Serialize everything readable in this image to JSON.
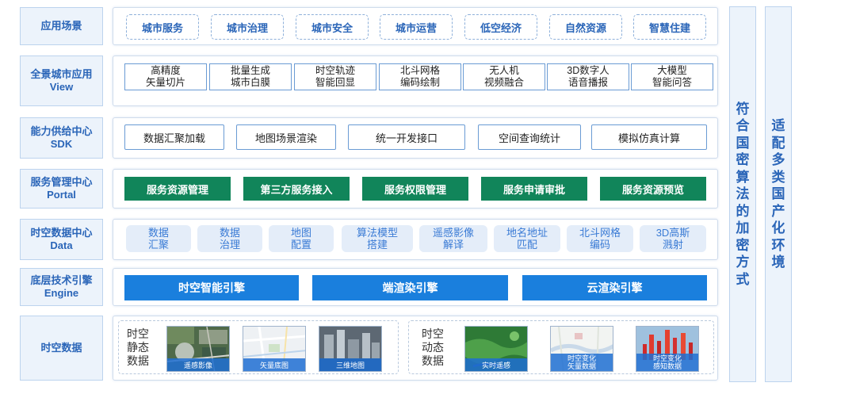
{
  "rows": {
    "application_scenes": {
      "label": [
        "应用场景"
      ],
      "items": [
        "城市服务",
        "城市治理",
        "城市安全",
        "城市运营",
        "低空经济",
        "自然资源",
        "智慧住建"
      ]
    },
    "view": {
      "label": [
        "全景城市应用",
        "View"
      ],
      "items": [
        [
          "高精度",
          "矢量切片"
        ],
        [
          "批量生成",
          "城市白膜"
        ],
        [
          "时空轨迹",
          "智能回显"
        ],
        [
          "北斗网格",
          "编码绘制"
        ],
        [
          "无人机",
          "视频融合"
        ],
        [
          "3D数字人",
          "语音播报"
        ],
        [
          "大模型",
          "智能问答"
        ]
      ]
    },
    "sdk": {
      "label": [
        "能力供给中心",
        "SDK"
      ],
      "items": [
        "数据汇聚加载",
        "地图场景渲染",
        "统一开发接口",
        "空间查询统计",
        "模拟仿真计算"
      ]
    },
    "portal": {
      "label": [
        "服务管理中心",
        "Portal"
      ],
      "items": [
        "服务资源管理",
        "第三方服务接入",
        "服务权限管理",
        "服务申请审批",
        "服务资源预览"
      ]
    },
    "data": {
      "label": [
        "时空数据中心",
        "Data"
      ],
      "items": [
        [
          "数据",
          "汇聚"
        ],
        [
          "数据",
          "治理"
        ],
        [
          "地图",
          "配置"
        ],
        [
          "算法模型",
          "搭建"
        ],
        [
          "遥感影像",
          "解译"
        ],
        [
          "地名地址",
          "匹配"
        ],
        [
          "北斗网格",
          "编码"
        ],
        [
          "3D高斯",
          "溅射"
        ]
      ]
    },
    "engine": {
      "label": [
        "底层技术引擎",
        "Engine"
      ],
      "items": [
        "时空智能引擎",
        "端渲染引擎",
        "云渲染引擎"
      ]
    },
    "spatiotemporal_data": {
      "label": [
        "时空数据"
      ],
      "static": {
        "title": [
          "时空",
          "静态",
          "数据"
        ],
        "thumbs": [
          "遥感影像",
          "矢量底图",
          "三维地图"
        ]
      },
      "dynamic": {
        "title": [
          "时空",
          "动态",
          "数据"
        ],
        "thumbs": [
          [
            "实时遥感"
          ],
          [
            "时空变化",
            "矢量数据"
          ],
          [
            "时空变化",
            "感知数据"
          ]
        ]
      }
    }
  },
  "side": {
    "crypto": [
      "符",
      "合",
      "国",
      "密",
      "算",
      "法",
      "的",
      "加",
      "密",
      "方",
      "式"
    ],
    "domestic": [
      "适",
      "配",
      "多",
      "类",
      "国",
      "产",
      "化",
      "环",
      "境"
    ]
  },
  "colors": {
    "label_text": "#2a65b8",
    "portal_green": "#11855a",
    "engine_blue": "#1a7fdd",
    "data_chip_bg": "#e4edf9"
  }
}
